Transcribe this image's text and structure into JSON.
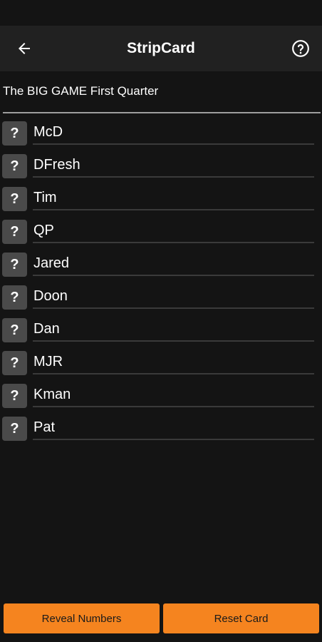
{
  "app_bar": {
    "title": "StripCard",
    "back_icon": "arrow-left-icon",
    "help_icon": "help-circle-icon"
  },
  "card": {
    "title": "The BIG GAME First Quarter"
  },
  "players": [
    {
      "badge": "?",
      "name": "McD"
    },
    {
      "badge": "?",
      "name": "DFresh"
    },
    {
      "badge": "?",
      "name": "Tim"
    },
    {
      "badge": "?",
      "name": "QP"
    },
    {
      "badge": "?",
      "name": "Jared"
    },
    {
      "badge": "?",
      "name": "Doon"
    },
    {
      "badge": "?",
      "name": "Dan"
    },
    {
      "badge": "?",
      "name": "MJR"
    },
    {
      "badge": "?",
      "name": "Kman"
    },
    {
      "badge": "?",
      "name": "Pat"
    }
  ],
  "actions": {
    "reveal_label": "Reveal Numbers",
    "reset_label": "Reset Card"
  },
  "colors": {
    "background": "#141414",
    "app_bar": "#212121",
    "accent": "#f5841f",
    "badge": "#4a4a4a"
  }
}
